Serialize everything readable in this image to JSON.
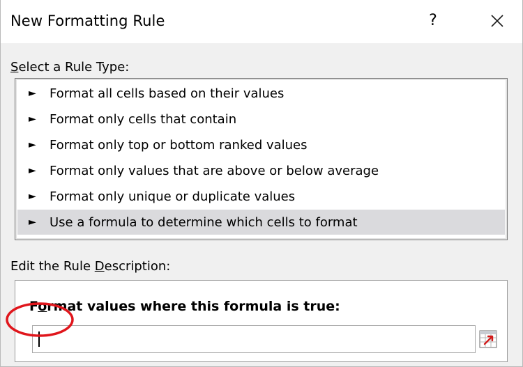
{
  "dialog": {
    "title": "New Formatting Rule",
    "help_label": "?"
  },
  "select_rule_type": {
    "label_accel": "S",
    "label_rest": "elect a Rule Type:",
    "items": [
      {
        "arrow": "►",
        "label": "Format all cells based on their values"
      },
      {
        "arrow": "►",
        "label": "Format only cells that contain"
      },
      {
        "arrow": "►",
        "label": "Format only top or bottom ranked values"
      },
      {
        "arrow": "►",
        "label": "Format only values that are above or below average"
      },
      {
        "arrow": "►",
        "label": "Format only unique or duplicate values"
      },
      {
        "arrow": "►",
        "label": "Use a formula to determine which cells to format"
      }
    ],
    "selected_index": 5
  },
  "edit_rule_description": {
    "label_start": "Edit the Rule ",
    "label_accel": "D",
    "label_rest": "escription:",
    "heading_start": "F",
    "heading_accel": "o",
    "heading_rest": "rmat values where this formula is true:",
    "formula_value": ""
  },
  "icons": {
    "close": "close-icon",
    "range_selector": "collapse-dialog-icon"
  },
  "colors": {
    "selected_row": "#dadadd",
    "panel_background": "#f0f0f0",
    "highlight_ring": "#e0161c"
  }
}
